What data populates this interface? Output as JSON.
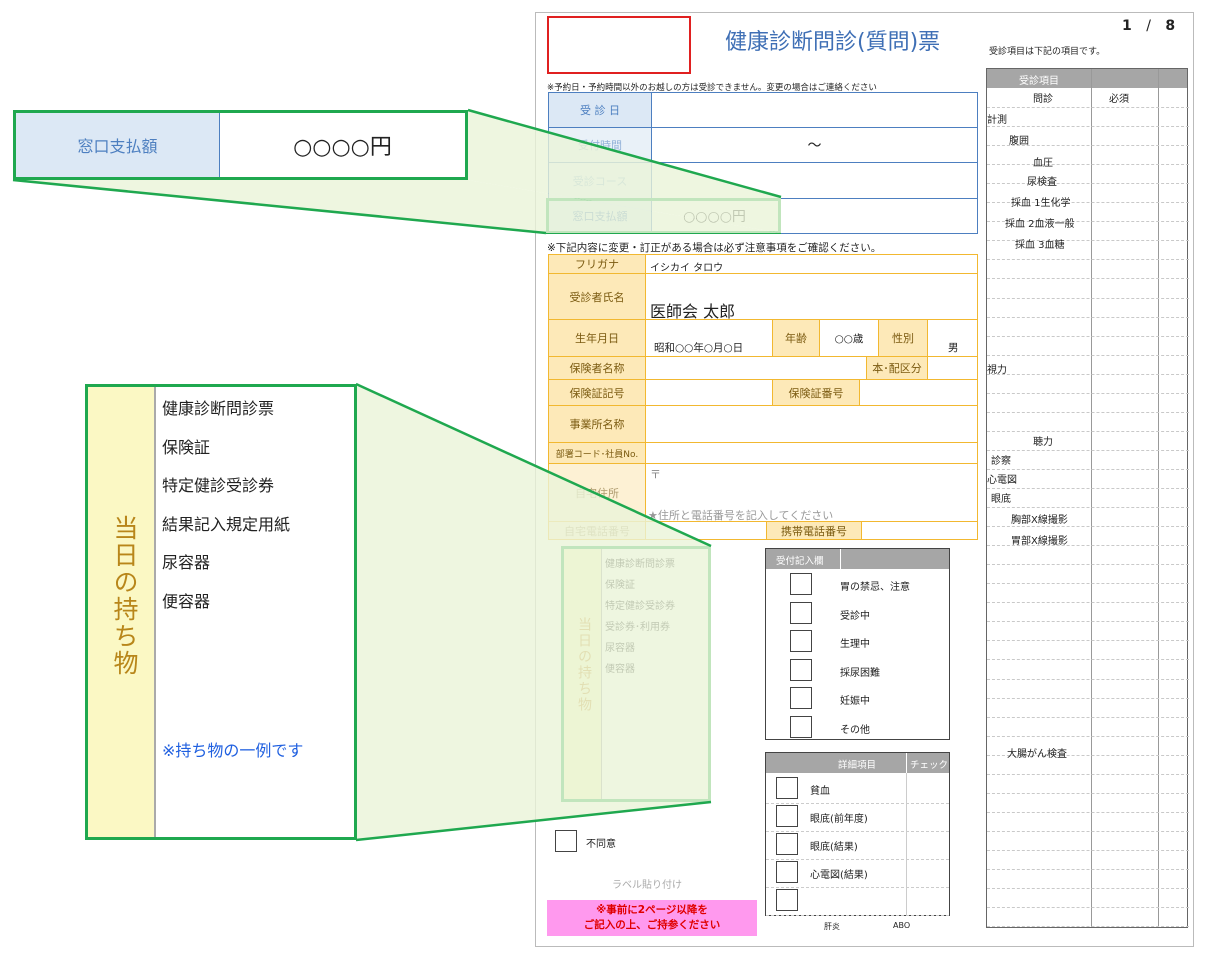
{
  "page": {
    "number": "1",
    "separator": "/",
    "total": "8"
  },
  "form": {
    "title": "健康診断問診(質問)票",
    "notice_top": "※予約日・予約時間以外のお越しの方は受診できません。変更の場合はご連絡ください",
    "notice_mid": "※下記内容に変更・訂正がある場合は必ず注意事項をご確認ください。",
    "reception": {
      "exam_date_label": "受 診 日",
      "reception_time_label": "受付時間",
      "reception_time_value": "～",
      "course_label": "受診コース",
      "payment_label": "窓口支払額",
      "payment_value": "○○○○円"
    },
    "patient": {
      "furigana_label": "フリガナ",
      "furigana_value": "イシカイ タロウ",
      "name_label": "受診者氏名",
      "name_value": "医師会 太郎",
      "dob_label": "生年月日",
      "dob_value": "昭和○○年○月○日",
      "age_label": "年齢",
      "age_value": "○○歳",
      "sex_label": "性別",
      "sex_value": "男",
      "insurer_label": "保険者名称",
      "dependent_label": "本･配区分",
      "card_code_label": "保険証記号",
      "card_number_label": "保険証番号",
      "office_label": "事業所名称",
      "dept_label": "部署コード･社員No.",
      "address_label": "自宅住所",
      "postal_mark": "〒",
      "address_hint": "★住所と電話番号を記入してください",
      "home_phone_label": "自宅電話番号",
      "mobile_phone_label": "携帯電話番号"
    },
    "belongings": {
      "heading": "当日の持ち物",
      "items": [
        "健康診断問診票",
        "保険証",
        "特定健診受診券",
        "受診券･利用券",
        "尿容器",
        "便容器"
      ]
    },
    "reception_checks": {
      "heading": "受付記入欄",
      "items": [
        "胃の禁忌、注意",
        "受診中",
        "生理中",
        "採尿困難",
        "妊娠中",
        "その他"
      ]
    },
    "detail_checks": {
      "heading": "詳細項目",
      "check_label": "チェック",
      "items": [
        "貧血",
        "眼底(前年度)",
        "眼底(結果)",
        "心電図(結果)",
        ""
      ],
      "footer_left": "肝炎",
      "footer_right": "ABO"
    },
    "disagree_label": "不同意",
    "label_area": "ラベル貼り付け",
    "pink_note_line1": "※事前に2ページ以降を",
    "pink_note_line2": "ご記入の上、ご持参ください",
    "exam_items_caption": "受診項目は下記の項目です。",
    "exam_items": {
      "heading": "受診項目",
      "rows": [
        {
          "name": "問診",
          "mark": "必須"
        },
        {
          "name": "計測",
          "mark": ""
        },
        {
          "name": "腹囲",
          "mark": ""
        },
        {
          "name": "血圧",
          "mark": ""
        },
        {
          "name": "尿検査",
          "mark": ""
        },
        {
          "name": "採血 1生化学",
          "mark": ""
        },
        {
          "name": "採血 2血液一般",
          "mark": ""
        },
        {
          "name": "採血 3血糖",
          "mark": ""
        },
        {
          "name": "視力",
          "mark": ""
        },
        {
          "name": "聴力",
          "mark": ""
        },
        {
          "name": "診察",
          "mark": ""
        },
        {
          "name": "心電図",
          "mark": ""
        },
        {
          "name": "眼底",
          "mark": ""
        },
        {
          "name": "胸部X線撮影",
          "mark": ""
        },
        {
          "name": "胃部X線撮影",
          "mark": ""
        },
        {
          "name": "大腸がん検査",
          "mark": ""
        }
      ]
    }
  },
  "callouts": {
    "payment_label": "窓口支払額",
    "payment_value": "○○○○円",
    "belongings_heading": "当日の持ち物",
    "belongings_items": [
      "健康診断問診票",
      "保険証",
      "特定健診受診券",
      "結果記入規定用紙",
      "尿容器",
      "便容器"
    ],
    "belongings_note": "※持ち物の一例です"
  },
  "colors": {
    "accent_blue": "#3f6fb5",
    "callout_green": "#1fa84f",
    "orange": "#f2b830",
    "pink": "#ff99ee",
    "red_box": "#e02020"
  }
}
